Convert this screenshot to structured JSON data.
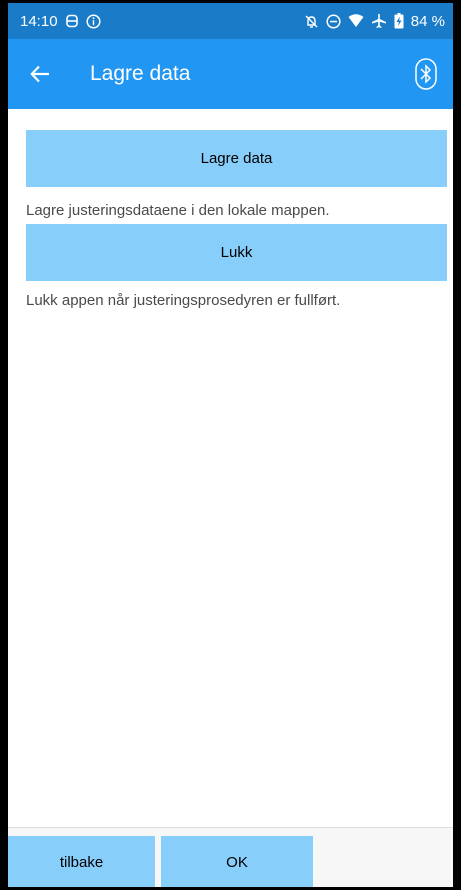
{
  "status_bar": {
    "time": "14:10",
    "battery": "84 %",
    "icons": [
      "sync-icon",
      "info-icon",
      "notifications-off-icon",
      "do-not-disturb-icon",
      "wifi-icon",
      "airplane-icon",
      "battery-charging-icon"
    ]
  },
  "app_bar": {
    "title": "Lagre data",
    "back_icon": "arrow-left-icon",
    "bluetooth_icon": "bluetooth-icon"
  },
  "actions": {
    "save": {
      "label": "Lagre data",
      "description": "Lagre justeringsdataene i den lokale mappen."
    },
    "close": {
      "label": "Lukk",
      "description": "Lukk appen når justeringsprosedyren er fullført."
    }
  },
  "bottom_nav": {
    "back_label": "tilbake",
    "ok_label": "OK"
  },
  "colors": {
    "status_bar": "#1a7cc9",
    "app_bar": "#2196f3",
    "button": "#87cefa"
  }
}
